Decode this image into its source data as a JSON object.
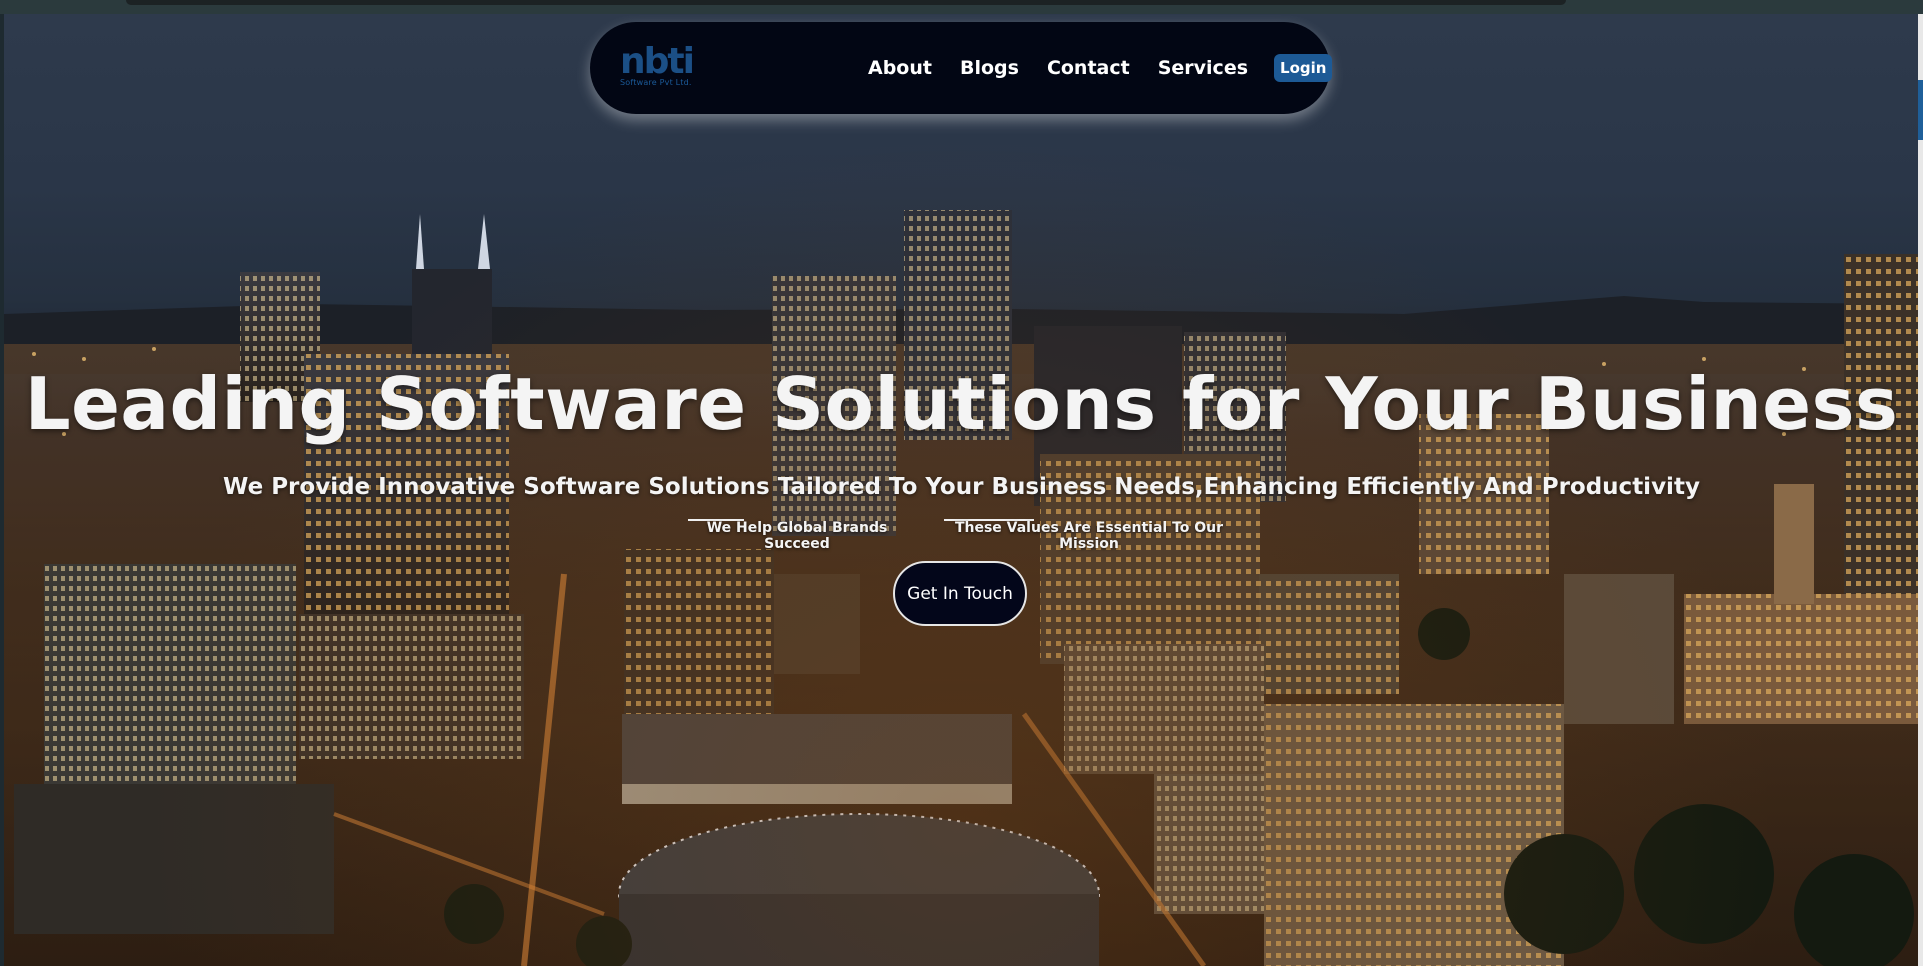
{
  "nav": {
    "logo_text": "nbti",
    "logo_subtitle": "Software Pvt Ltd.",
    "links": [
      "About",
      "Blogs",
      "Contact",
      "Services"
    ],
    "login_label": "Login"
  },
  "hero": {
    "title": "Leading Software Solutions for Your Business",
    "subtitle": "We Provide Innovative Software Solutions Tailored To Your Business Needs,Enhancing Efficiently And Productivity",
    "taglines": [
      "We Help Global Brands Succeed",
      "These Values Are Essential To Our Mission"
    ],
    "cta_label": "Get In Touch"
  },
  "colors": {
    "nav_bg": "#020614",
    "login_bg": "#1d5a96",
    "logo": "#1b4f86",
    "cta_bg": "#03061a"
  }
}
